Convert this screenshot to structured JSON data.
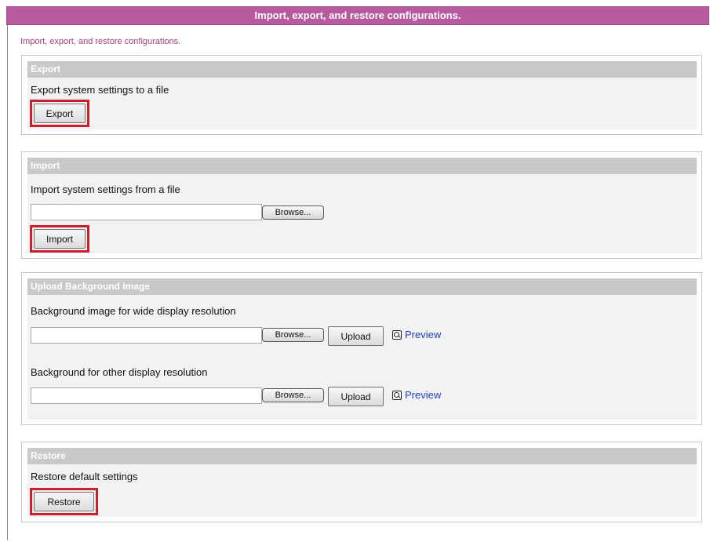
{
  "header": {
    "title": "Import, export, and restore configurations.",
    "subtitle": "Import, export, and restore configurations."
  },
  "export": {
    "heading": "Export",
    "description": "Export system settings to a file",
    "button_label": "Export"
  },
  "import": {
    "heading": "Import",
    "description": "Import system settings from a file",
    "file_value": "",
    "browse_label": "Browse...",
    "button_label": "Import"
  },
  "upload": {
    "heading": "Upload Background Image",
    "wide": {
      "description": "Background image for wide display resolution",
      "file_value": "",
      "browse_label": "Browse...",
      "upload_label": "Upload",
      "preview_label": "Preview"
    },
    "other": {
      "description": "Background for other display resolution",
      "file_value": "",
      "browse_label": "Browse...",
      "upload_label": "Upload",
      "preview_label": "Preview"
    }
  },
  "restore": {
    "heading": "Restore",
    "description": "Restore default settings",
    "button_label": "Restore"
  },
  "colors": {
    "title_bar": "#b85aa0",
    "subtitle_text": "#a0407c",
    "section_header": "#c9c9c9",
    "highlight": "#cc1e2e",
    "link": "#1f3fbf"
  },
  "icons": {
    "preview": "magnifier-icon"
  }
}
